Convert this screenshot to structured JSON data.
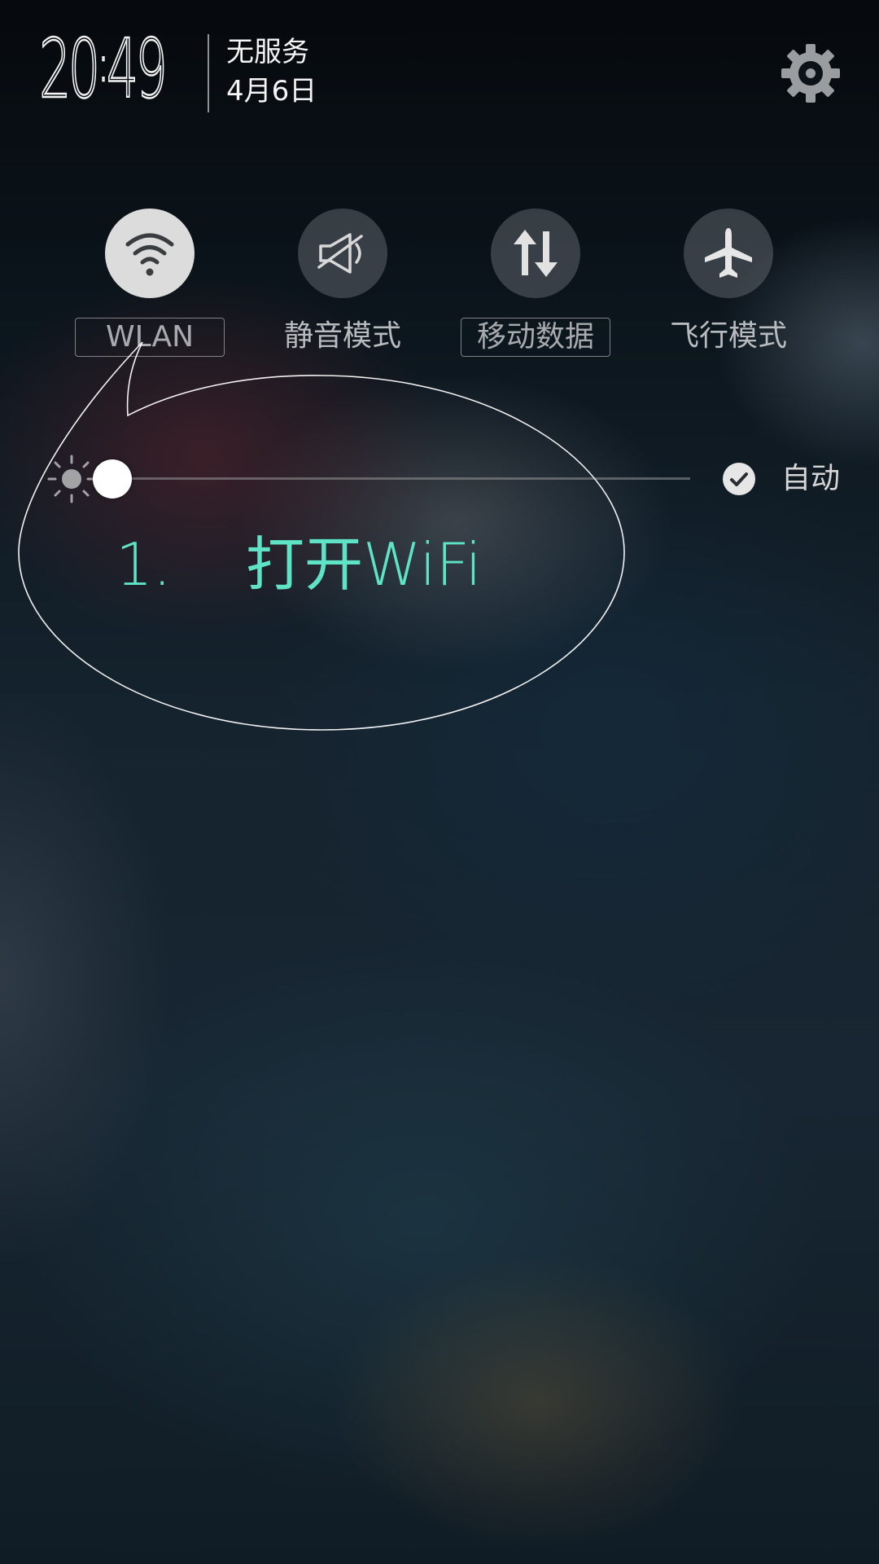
{
  "status": {
    "time_hours": "20",
    "time_sep": ":",
    "time_minutes": "49",
    "carrier": "无服务",
    "date": "4月6日"
  },
  "header": {
    "settings_icon": "gear-icon"
  },
  "quick_toggles": [
    {
      "label": "WLAN",
      "icon": "wifi-icon",
      "active": true
    },
    {
      "label": "静音模式",
      "icon": "mute-speaker-icon",
      "active": false
    },
    {
      "label": "移动数据",
      "icon": "mobile-data-arrows-icon",
      "active": false
    },
    {
      "label": "飞行模式",
      "icon": "airplane-icon",
      "active": false
    }
  ],
  "brightness": {
    "level": 0.0,
    "auto_label": "自动",
    "auto_checked": true
  },
  "annotation": {
    "number": "1.",
    "text": "打开WiFi",
    "color": "#5fe3c6"
  }
}
